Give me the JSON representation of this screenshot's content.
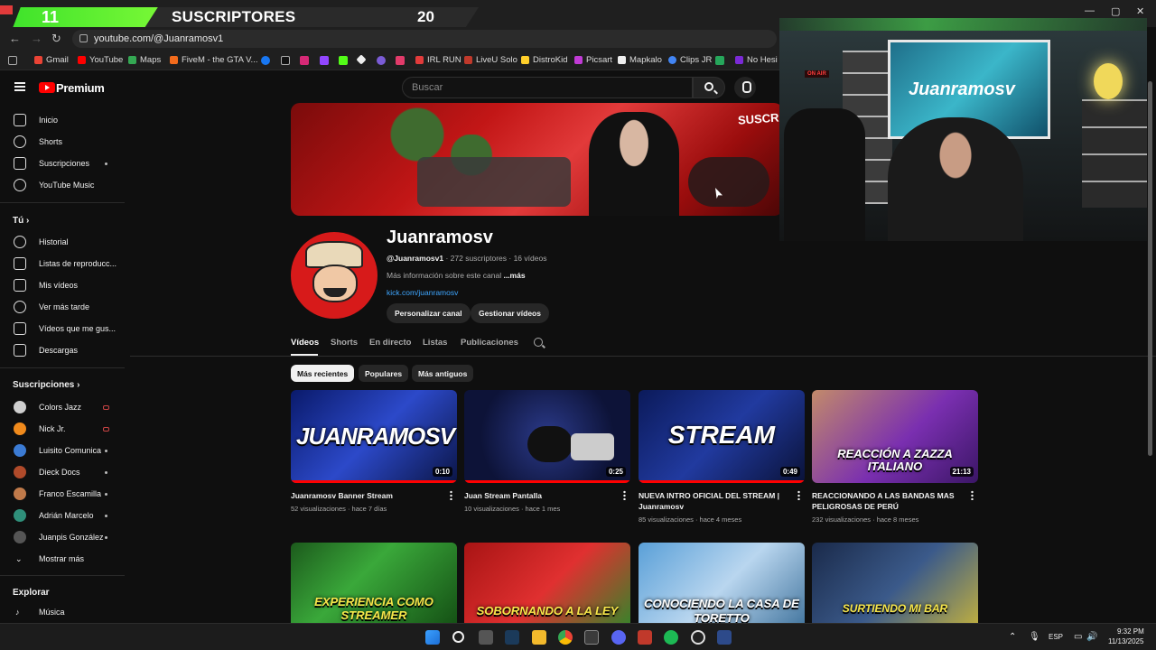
{
  "overlay": {
    "left_count": "11",
    "label": "SUSCRIPTORES",
    "right_count": "20"
  },
  "window_controls": [
    "—",
    "▢",
    "✕"
  ],
  "browser": {
    "url": "youtube.com/@Juanramosv1",
    "bookmarks": [
      "Gmail",
      "YouTube",
      "Maps",
      "FiveM - the GTA V...",
      "IRL RUN",
      "LiveU Solo",
      "DistroKid",
      "Picsart",
      "Mapkalo",
      "Clips JR",
      "No Hesi |"
    ]
  },
  "youtube": {
    "brand": "Premium",
    "search_placeholder": "Buscar"
  },
  "sidebar": {
    "main": [
      "Inicio",
      "Shorts",
      "Suscripciones",
      "YouTube Music"
    ],
    "you_header": "Tú",
    "you": [
      "Historial",
      "Listas de reproducc...",
      "Mis vídeos",
      "Ver más tarde",
      "Vídeos que me gus...",
      "Descargas"
    ],
    "subs_header": "Suscripciones",
    "subscriptions": [
      {
        "name": "Colors Jazz",
        "color": "#cfcfcf"
      },
      {
        "name": "Nick Jr.",
        "color": "#f08a1c"
      },
      {
        "name": "Luisito Comunica",
        "color": "#3b7bd4"
      },
      {
        "name": "Dieck Docs",
        "color": "#b04a2a"
      },
      {
        "name": "Franco Escamilla",
        "color": "#c07a4a"
      },
      {
        "name": "Adrián Marcelo",
        "color": "#2f8f7a"
      },
      {
        "name": "Juanpis González",
        "color": "#555555"
      }
    ],
    "show_more": "Mostrar más",
    "explore_header": "Explorar",
    "explore": [
      "Música"
    ]
  },
  "channel": {
    "name": "Juanramosv",
    "handle": "@Juanramosv1",
    "subscribers": " · 272 suscriptores · 16 vídeos",
    "description": "Más información sobre este canal ",
    "more": "...más",
    "link": "kick.com/juanramosv",
    "buttons": [
      "Personalizar canal",
      "Gestionar vídeos"
    ],
    "banner_text": "SUSCRI"
  },
  "tabs": [
    "Vídeos",
    "Shorts",
    "En directo",
    "Listas",
    "Publicaciones"
  ],
  "filters": [
    "Más recientes",
    "Populares",
    "Más antiguos"
  ],
  "videos": [
    {
      "title": "Juanramosv Banner Stream",
      "meta": "52 visualizaciones · hace 7 días",
      "duration": "0:10",
      "thumb_text": "JUANRAMOSV",
      "progress": 1.0
    },
    {
      "title": "Juan Stream Pantalla",
      "meta": "10 visualizaciones · hace 1 mes",
      "duration": "0:25",
      "thumb_text": "",
      "progress": 1.0
    },
    {
      "title": "NUEVA INTRO OFICIAL DEL STREAM | Juanramosv",
      "meta": "85 visualizaciones · hace 4 meses",
      "duration": "0:49",
      "thumb_text": "STREAM",
      "progress": 1.0
    },
    {
      "title": "REACCIONANDO A LAS BANDAS MAS PELIGROSAS DE PERÚ",
      "meta": "232 visualizaciones · hace 8 meses",
      "duration": "21:13",
      "thumb_text": "REACCIÓN A ZAZZA ITALIANO",
      "progress": 0.0
    },
    {
      "title": "",
      "meta": "",
      "duration": "",
      "thumb_text": "EXPERIENCIA COMO STREAMER",
      "progress": 0.0
    },
    {
      "title": "",
      "meta": "",
      "duration": "",
      "thumb_text": "SOBORNANDO A LA LEY",
      "progress": 0.0
    },
    {
      "title": "",
      "meta": "",
      "duration": "",
      "thumb_text": "CONOCIENDO LA CASA DE TORETTO",
      "progress": 0.0
    },
    {
      "title": "",
      "meta": "",
      "duration": "",
      "thumb_text": "SURTIENDO MI BAR",
      "progress": 0.0
    }
  ],
  "webcam": {
    "tv_text": "Juanramosv",
    "on_air": "ON AIR"
  },
  "taskbar": {
    "lang": "ESP",
    "time": "9:32 PM",
    "date": "11/13/2025"
  }
}
